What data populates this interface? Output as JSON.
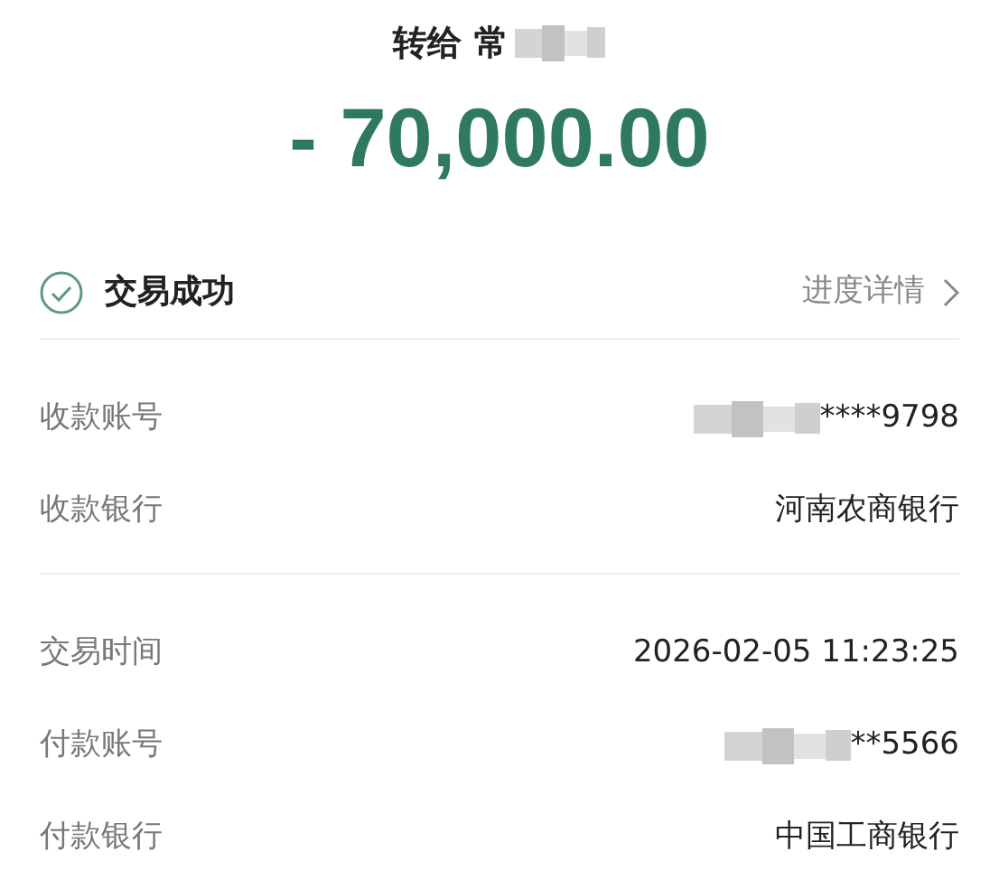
{
  "header": {
    "title": "转给 常",
    "masked": true,
    "amount": "- 70,000.00"
  },
  "status": {
    "label": "交易成功",
    "link": "进度详情"
  },
  "sections": [
    {
      "rows": [
        {
          "label": "收款账号",
          "value": "****9798",
          "masked": true
        },
        {
          "label": "收款银行",
          "value": "河南农商银行",
          "masked": false
        }
      ]
    },
    {
      "rows": [
        {
          "label": "交易时间",
          "value": "2026-02-05 11:23:25",
          "masked": false
        },
        {
          "label": "付款账号",
          "value": "**5566",
          "masked": true
        },
        {
          "label": "付款银行",
          "value": "中国工商银行",
          "masked": false
        }
      ]
    }
  ]
}
